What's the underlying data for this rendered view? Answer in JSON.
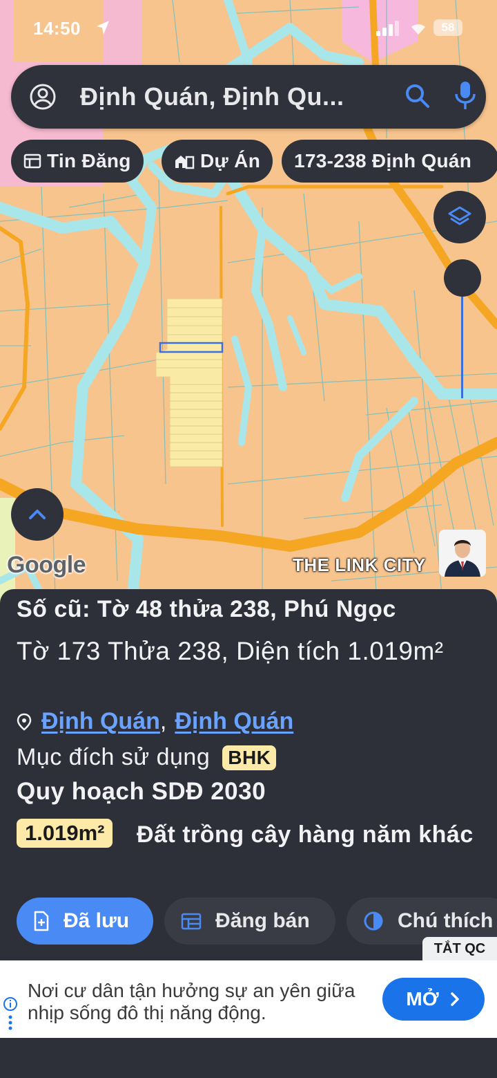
{
  "status_bar": {
    "time": "14:50",
    "battery": "58"
  },
  "search": {
    "query": "Định Quán, Định Qu..."
  },
  "chips": [
    {
      "label": "Tin Đăng",
      "icon": "listing-icon"
    },
    {
      "label": "Dự Án",
      "icon": "building-icon"
    },
    {
      "label": "173-238 Định Quán",
      "icon": ""
    }
  ],
  "map": {
    "google_label": "Google",
    "brand_label": "THE LINK CITY"
  },
  "parcel": {
    "old_number": "Số cũ: Tờ 48 thửa 238, Phú Ngọc",
    "lot_info": "Tờ 173 Thửa 238, Diện tích 1.019m²",
    "address": {
      "district": "Định Quán",
      "separator": ",",
      "town": "Định Quán"
    },
    "usage_label": "Mục đích sử dụng",
    "usage_code": "BHK",
    "plan_title": "Quy hoạch SDĐ 2030",
    "plan_area": "1.019m²",
    "plan_description": "Đất trồng cây hàng năm khác"
  },
  "actions": [
    {
      "label": "Đã lưu",
      "icon": "saved-doc-icon"
    },
    {
      "label": "Đăng bán",
      "icon": "post-sale-icon"
    },
    {
      "label": "Chú thích",
      "icon": "legend-icon"
    }
  ],
  "ad": {
    "hide_label": "TẮT QC",
    "text": "Nơi cư dân tận hưởng sự an yên giữa nhịp sống đô thị năng động.",
    "open_label": "MỞ"
  },
  "colors": {
    "map_land": "#f8c48e",
    "map_water": "#a8e6ea",
    "map_road": "#f5a623",
    "panel_bg": "#2d3038",
    "accent_blue": "#4a8af4",
    "highlight_yellow": "#fde9a8"
  }
}
